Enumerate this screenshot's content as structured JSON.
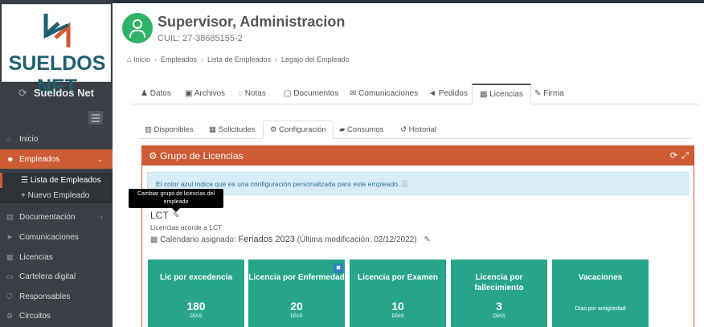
{
  "app": {
    "logo_text": "SUELDOS NET",
    "brand": "Sueldos Net"
  },
  "sidebar": {
    "items": [
      {
        "label": "Inicio",
        "icon": "home-icon"
      },
      {
        "label": "Empleados",
        "icon": "users-icon"
      },
      {
        "label": "Documentación",
        "icon": "file-icon"
      },
      {
        "label": "Comunicaciones",
        "icon": "send-icon"
      },
      {
        "label": "Licencias",
        "icon": "calendar-icon"
      },
      {
        "label": "Cartelera digital",
        "icon": "board-icon"
      },
      {
        "label": "Responsables",
        "icon": "shield-icon"
      },
      {
        "label": "Circuitos",
        "icon": "circuit-icon"
      }
    ],
    "subitems": [
      {
        "label": "Lista de Empleados"
      },
      {
        "label": "Nuevo Empleado"
      }
    ]
  },
  "employee": {
    "name": "Supervisor, Administracion",
    "cuil": "CUIL: 27-38685155-2"
  },
  "breadcrumb": [
    "Inicio",
    "Empleados",
    "Lista de Empleados",
    "Legajo del Empleado"
  ],
  "tabs": [
    {
      "label": "Datos"
    },
    {
      "label": "Archivos"
    },
    {
      "label": "Notas"
    },
    {
      "label": "Documentos"
    },
    {
      "label": "Comunicaciones"
    },
    {
      "label": "Pedidos"
    },
    {
      "label": "Licencias"
    },
    {
      "label": "Firma"
    }
  ],
  "subtabs": [
    {
      "label": "Disponibles"
    },
    {
      "label": "Solicitudes"
    },
    {
      "label": "Configuración"
    },
    {
      "label": "Consumos"
    },
    {
      "label": "Historial"
    }
  ],
  "panel": {
    "title": "Grupo de Licencias",
    "info": "El color azul indica que es una configuración personalizada para este empleado.",
    "tooltip": "Cambiar grupo de licencias del empleado",
    "group_code": "LCT",
    "group_desc": "Licencias acorde a LCT",
    "calendar_label": "Calendario asignado:",
    "calendar_value": "Feriados 2023",
    "calendar_mod": "(Última modificación: 02/12/2022)"
  },
  "cards": [
    {
      "title": "Lic por excedencia",
      "value": "180",
      "unit": "DÍAS"
    },
    {
      "title": "Licencia por Enfermedad",
      "value": "20",
      "unit": "DÍAS"
    },
    {
      "title": "Licencia por Examen",
      "value": "10",
      "unit": "DÍAS"
    },
    {
      "title": "Licencia por fallecimiento",
      "value": "3",
      "unit": "DÍAS"
    },
    {
      "title": "Vacaciones",
      "desc": "Días por antigüedad"
    }
  ],
  "colors": {
    "accent": "#cd5b33",
    "card": "#26a58b",
    "sidebar": "#3b4047",
    "avatar": "#2fb36a"
  }
}
